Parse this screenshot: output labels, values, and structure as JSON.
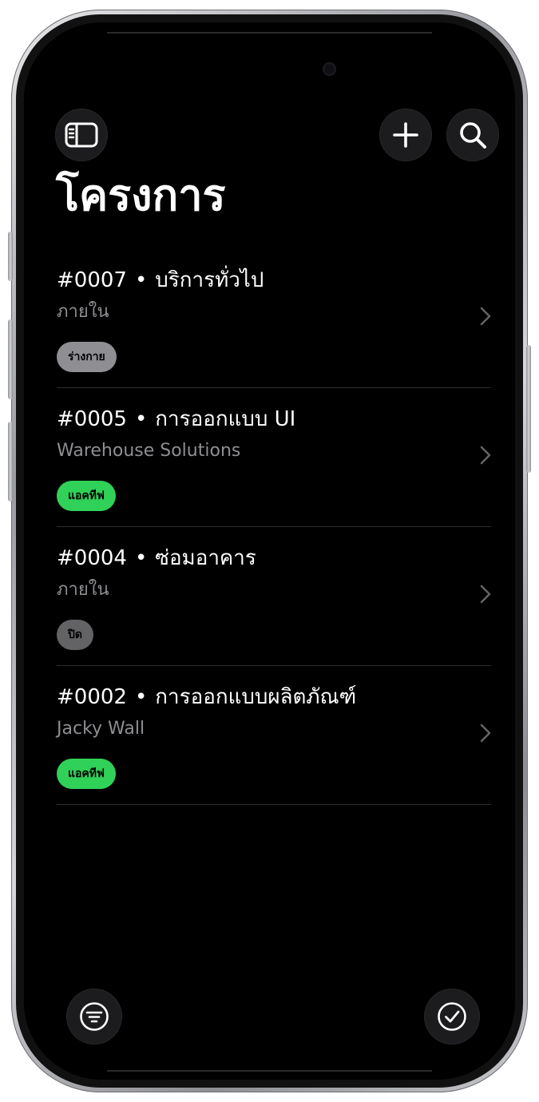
{
  "header": {
    "title": "โครงการ",
    "sidebar_icon": "sidebar-icon",
    "add_icon": "plus-icon",
    "search_icon": "search-icon"
  },
  "projects": [
    {
      "code": "#0007",
      "name": "บริการทั่วไป",
      "client": "ภายใน",
      "status": "ร่างกาย",
      "status_color": "#8e8e93"
    },
    {
      "code": "#0005",
      "name": "การออกแบบ UI",
      "client": "Warehouse Solutions",
      "status": "แอคทีฟ",
      "status_color": "#30d158"
    },
    {
      "code": "#0004",
      "name": "ซ่อมอาคาร",
      "client": "ภายใน",
      "status": "ปิด",
      "status_color": "#636366"
    },
    {
      "code": "#0002",
      "name": "การออกแบบผลิตภัณฑ์",
      "client": "Jacky Wall",
      "status": "แอคทีฟ",
      "status_color": "#30d158"
    }
  ],
  "separator": "•",
  "footer": {
    "filter_icon": "filter-icon",
    "select_icon": "checkmark-circle-icon"
  }
}
